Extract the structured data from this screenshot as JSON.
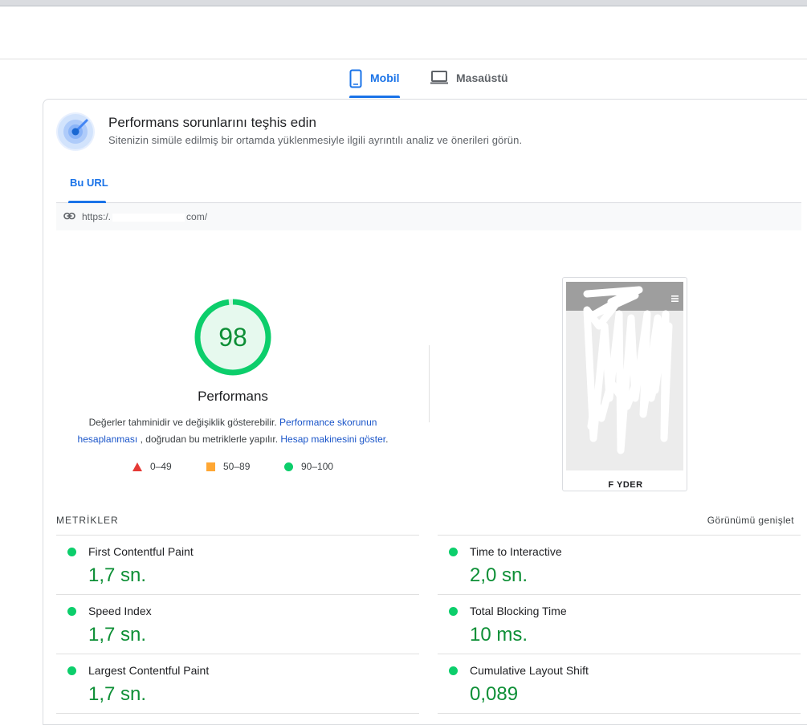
{
  "device_tabs": [
    {
      "label": "Mobil",
      "icon": "smartphone-icon",
      "selected": true
    },
    {
      "label": "Masaüstü",
      "icon": "laptop-icon",
      "selected": false
    }
  ],
  "header": {
    "icon": "radar-icon",
    "title": "Performans sorunlarını teşhis edin",
    "subtitle": "Sitenizin simüle edilmiş bir ortamda yüklenmesiyle ilgili ayrıntılı analiz ve önerileri görün."
  },
  "url_tab": {
    "label": "Bu URL"
  },
  "url_bar": {
    "icon": "link-icon",
    "prefix": "https:/.",
    "suffix": "com/"
  },
  "score": {
    "value": "98",
    "fraction": 0.98,
    "label": "Performans"
  },
  "note": {
    "text1": "Değerler tahminidir ve değişiklik gösterebilir.",
    "link1": "Performance skorunun hesaplanması",
    "text2": ", doğrudan bu metriklerle yapılır.",
    "link2": "Hesap makinesini göster",
    "text3": "."
  },
  "legend": [
    {
      "range": "0–49",
      "shape": "triangle",
      "color": "#e53935"
    },
    {
      "range": "50–89",
      "shape": "square",
      "color": "#ffa733"
    },
    {
      "range": "90–100",
      "shape": "circle",
      "color": "#0cce6b"
    }
  ],
  "screenshot": {
    "caption": "F   YDER"
  },
  "metrics_section": {
    "title": "METRİKLER",
    "expand_label": "Görünümü genişlet"
  },
  "metrics": [
    {
      "name": "First Contentful Paint",
      "value": "1,7 sn.",
      "status": "good"
    },
    {
      "name": "Time to Interactive",
      "value": "2,0 sn.",
      "status": "good"
    },
    {
      "name": "Speed Index",
      "value": "1,7 sn.",
      "status": "good"
    },
    {
      "name": "Total Blocking Time",
      "value": "10 ms.",
      "status": "good"
    },
    {
      "name": "Largest Contentful Paint",
      "value": "1,7 sn.",
      "status": "good"
    },
    {
      "name": "Cumulative Layout Shift",
      "value": "0,089",
      "status": "good"
    }
  ],
  "colors": {
    "accent": "#1a73e8",
    "good": "#0cce6b",
    "good_text": "#0d8f36"
  }
}
